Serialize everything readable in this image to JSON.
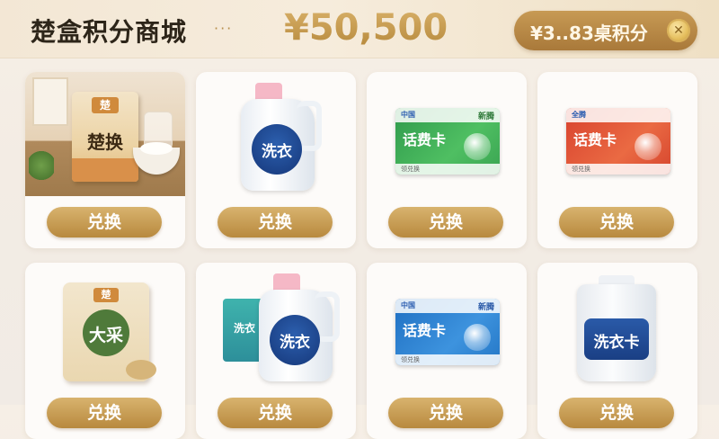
{
  "header": {
    "title": "楚盒积分商城",
    "dots": "···",
    "balance": "¥50,500",
    "points_label": "¥3..83桌积分",
    "coin_icon": "coin-icon"
  },
  "products": [
    {
      "name": "楚换",
      "brand_logo": "楚",
      "button_label": "兑换",
      "image": "flour-bag"
    },
    {
      "name": "洗衣",
      "button_label": "兑换",
      "image": "detergent-bottle"
    },
    {
      "name": "话费卡",
      "brand": "中国",
      "tag": "新腾",
      "foot": "领兑换",
      "button_label": "兑换",
      "image": "green-recharge-card"
    },
    {
      "name": "话费卡",
      "brand": "全腾",
      "foot": "领兑换",
      "button_label": "兑换",
      "image": "red-recharge-card"
    },
    {
      "name": "大采",
      "brand_logo": "楚",
      "button_label": "兑换",
      "image": "rice-bag"
    },
    {
      "name": "洗衣",
      "box_label": "洗衣",
      "button_label": "兑换",
      "image": "detergent-combo"
    },
    {
      "name": "话费卡",
      "brand": "中国",
      "tag": "新腾",
      "foot": "领兑换",
      "button_label": "兑换",
      "image": "blue-recharge-card"
    },
    {
      "name": "洗衣卡",
      "button_label": "兑换",
      "image": "detergent-tub"
    }
  ],
  "colors": {
    "accent_gold": "#b8893e",
    "title": "#2d2519",
    "background": "#f3ece4"
  }
}
